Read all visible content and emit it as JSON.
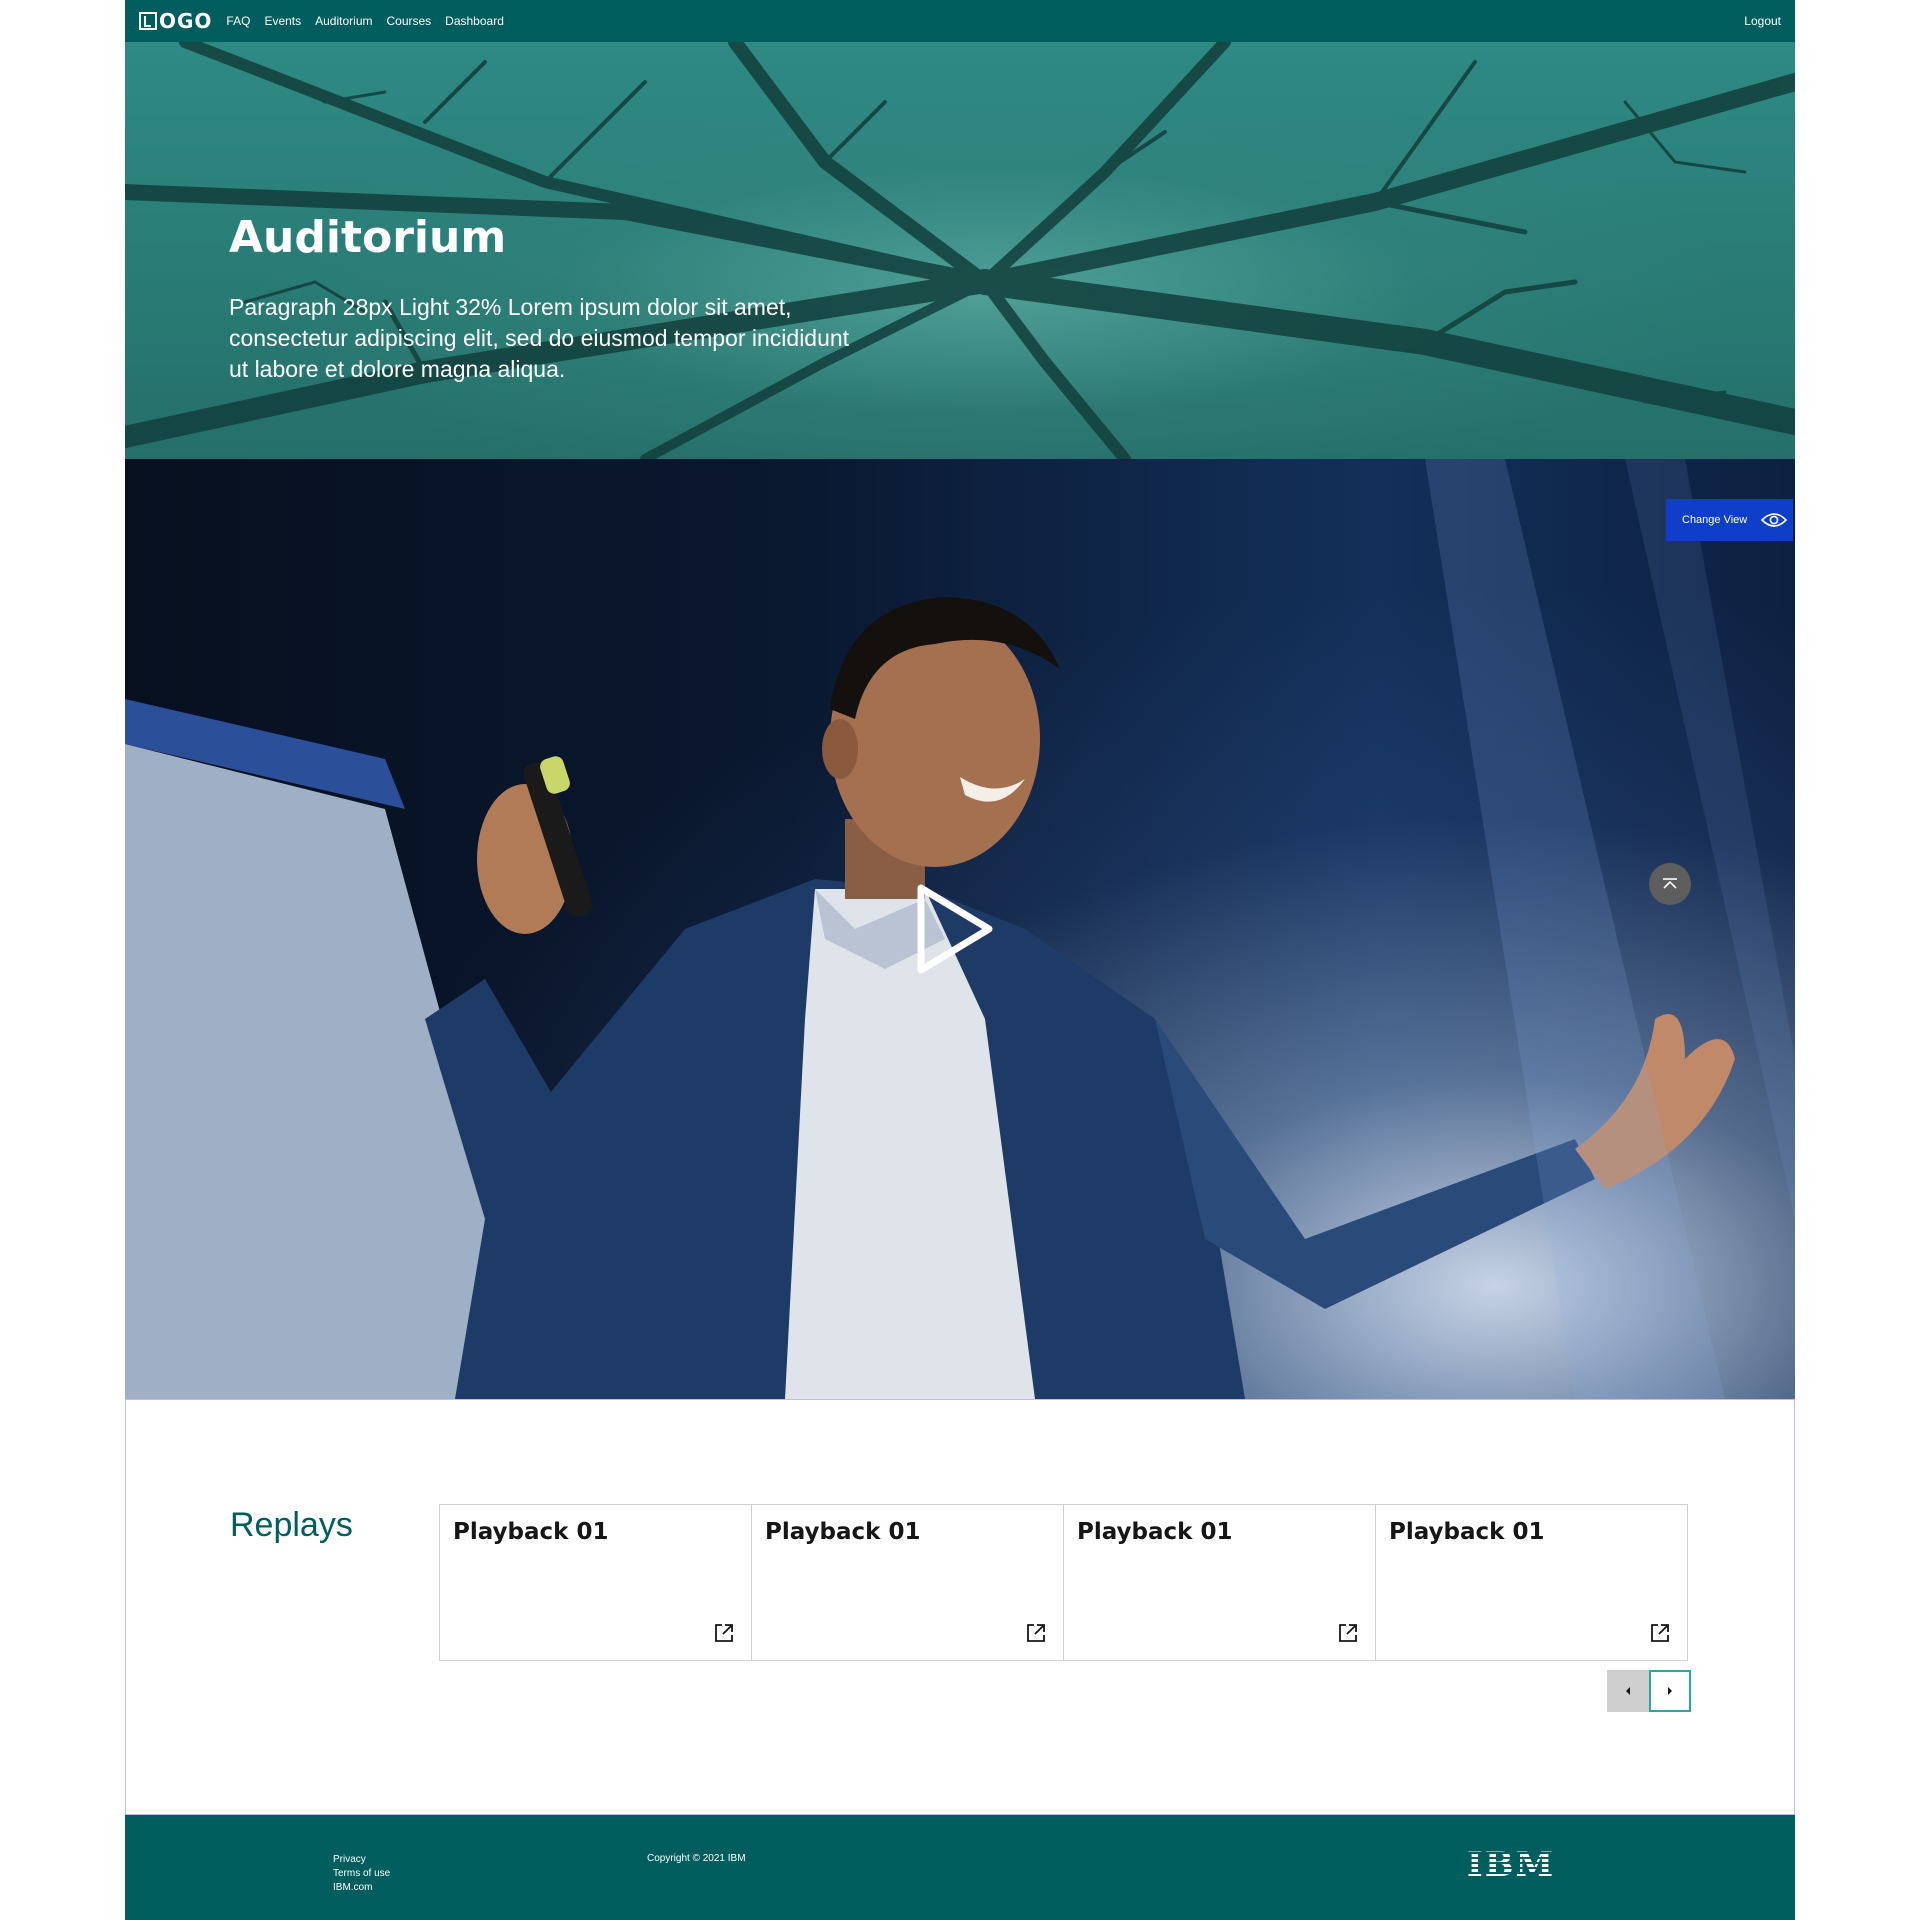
{
  "nav": {
    "logo_text": "OGO",
    "links": [
      "FAQ",
      "Events",
      "Auditorium",
      "Courses",
      "Dashboard"
    ],
    "logout": "Logout"
  },
  "hero": {
    "title": "Auditorium",
    "paragraph": "Paragraph 28px Light 32% Lorem ipsum dolor sit amet, consectetur adipiscing elit, sed do eiusmod tempor incididunt ut labore et dolore magna aliqua."
  },
  "video": {
    "change_view_label": "Change View"
  },
  "replays": {
    "title": "Replays",
    "cards": [
      {
        "title": "Playback 01"
      },
      {
        "title": "Playback 01"
      },
      {
        "title": "Playback 01"
      },
      {
        "title": "Playback 01"
      }
    ]
  },
  "footer": {
    "links": [
      "Privacy",
      "Terms of use",
      "IBM.com"
    ],
    "copyright": "Copyright © 2021 IBM",
    "brand": "IBM"
  },
  "colors": {
    "primary_teal": "#005d5d",
    "button_blue": "#0f3fc8",
    "pager_accent": "#2aa79b"
  }
}
